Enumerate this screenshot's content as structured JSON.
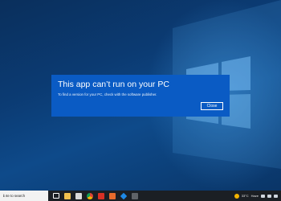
{
  "dialog": {
    "title": "This app can’t run on your PC",
    "message": "To find a version for your PC, check with the software publisher.",
    "close_label": "Close"
  },
  "taskbar": {
    "search_placeholder": "ℹ ıte to search",
    "apps": [
      {
        "name": "task-view-icon",
        "color": "#ffffff"
      },
      {
        "name": "file-explorer-icon",
        "color": "#f2c14e"
      },
      {
        "name": "notes-icon",
        "color": "#d9d9d9"
      },
      {
        "name": "chrome-icon",
        "color": "#e0e0e0"
      },
      {
        "name": "red-app-icon",
        "color": "#d93025"
      },
      {
        "name": "photos-icon",
        "color": "#e86b2c"
      },
      {
        "name": "dropbox-icon",
        "color": "#1e88e5"
      },
      {
        "name": "store-icon",
        "color": "#5f6368"
      }
    ],
    "weather": "33°C",
    "weather_condition": "Haze"
  }
}
